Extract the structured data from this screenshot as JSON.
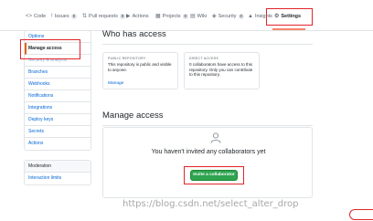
{
  "repo_nav": {
    "tabs": [
      {
        "label": "Code",
        "icon": "<>"
      },
      {
        "label": "Issues",
        "icon": "!",
        "count": "0"
      },
      {
        "label": "Pull requests",
        "icon": "⇅",
        "count": "0"
      },
      {
        "label": "Actions",
        "icon": "▶"
      },
      {
        "label": "Projects",
        "icon": "▦",
        "count": "0"
      },
      {
        "label": "Wiki",
        "icon": "▤"
      },
      {
        "label": "Security",
        "icon": "◈",
        "count": "0"
      },
      {
        "label": "Insights",
        "icon": "▲"
      },
      {
        "label": "Settings",
        "icon": "⚙"
      }
    ]
  },
  "sidebar": {
    "items": [
      {
        "label": "Options"
      },
      {
        "label": "Manage access"
      },
      {
        "label": "Security & analysis"
      },
      {
        "label": "Branches"
      },
      {
        "label": "Webhooks"
      },
      {
        "label": "Notifications"
      },
      {
        "label": "Integrations"
      },
      {
        "label": "Deploy keys"
      },
      {
        "label": "Secrets"
      },
      {
        "label": "Actions"
      }
    ],
    "moderation_heading": "Moderation",
    "moderation_items": [
      {
        "label": "Interaction limits"
      }
    ]
  },
  "main": {
    "who_heading": "Who has access",
    "public_card": {
      "caption": "PUBLIC REPOSITORY",
      "text": "This repository is public and visible to anyone.",
      "link": "Manage"
    },
    "direct_card": {
      "caption": "DIRECT ACCESS",
      "text": "0 collaborators have access to this repository. Only you can contribute to this repository."
    },
    "manage_heading": "Manage access",
    "empty_text": "You haven't invited any collaborators yet",
    "invite_button": "Invite a collaborator"
  },
  "watermark": "https://blog.csdn.net/select_alter_drop",
  "colors": {
    "link": "#0366d6",
    "accent_underline": "#f9826c",
    "button_green": "#2ea44f",
    "highlight_red": "#e0252b"
  }
}
